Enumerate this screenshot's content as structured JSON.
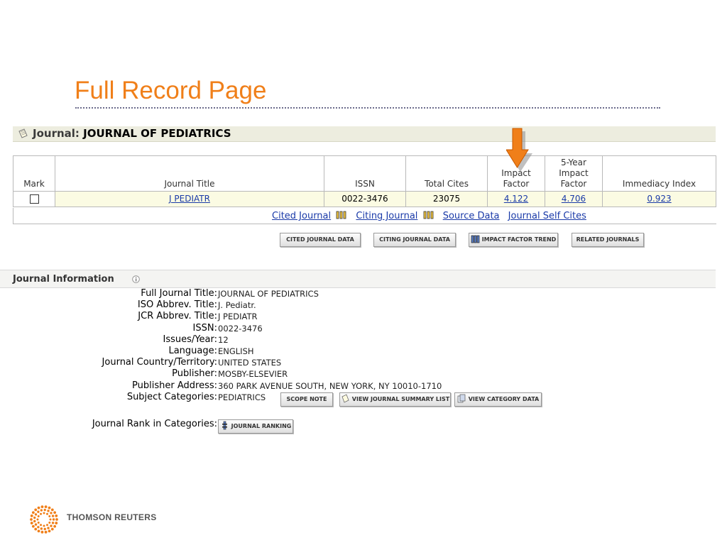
{
  "slide": {
    "title": "Full Record Page"
  },
  "journal": {
    "label": "Journal:",
    "name": "JOURNAL OF PEDIATRICS"
  },
  "table": {
    "headers": {
      "mark": "Mark",
      "title": "Journal Title",
      "issn": "ISSN",
      "total_cites": "Total Cites",
      "impact_factor_l1": "Impact",
      "impact_factor_l2": "Factor",
      "five_year_l1": "5-Year",
      "five_year_l2": "Impact",
      "five_year_l3": "Factor",
      "immediacy": "Immediacy Index"
    },
    "row": {
      "title": "J PEDIATR",
      "issn": "0022-3476",
      "total_cites": "23075",
      "impact_factor": "4.122",
      "five_year": "4.706",
      "immediacy": "0.923"
    }
  },
  "links": {
    "cited_journal": "Cited Journal",
    "citing_journal": "Citing Journal",
    "source_data": "Source Data",
    "self_cites": "Journal Self Cites"
  },
  "buttons": {
    "cited_data": "CITED JOURNAL DATA",
    "citing_data": "CITING JOURNAL DATA",
    "if_trend": "IMPACT FACTOR TREND",
    "related": "RELATED JOURNALS",
    "scope_note": "SCOPE NOTE",
    "summary_list": "VIEW JOURNAL SUMMARY LIST",
    "category_data": "VIEW CATEGORY DATA",
    "ranking": "JOURNAL RANKING"
  },
  "info": {
    "heading": "Journal Information",
    "fields": [
      {
        "key": "Full Journal Title:",
        "value": "JOURNAL OF PEDIATRICS"
      },
      {
        "key": "ISO Abbrev. Title:",
        "value": "J. Pediatr."
      },
      {
        "key": "JCR Abbrev. Title:",
        "value": "J PEDIATR"
      },
      {
        "key": "ISSN:",
        "value": "0022-3476"
      },
      {
        "key": "Issues/Year:",
        "value": "12"
      },
      {
        "key": "Language:",
        "value": "ENGLISH"
      },
      {
        "key": "Journal Country/Territory:",
        "value": "UNITED STATES"
      },
      {
        "key": "Publisher:",
        "value": "MOSBY-ELSEVIER"
      },
      {
        "key": "Publisher Address:",
        "value": "360 PARK AVENUE SOUTH, NEW YORK, NY 10010-1710"
      },
      {
        "key": "Subject Categories:",
        "value": "PEDIATRICS"
      }
    ],
    "rank_label": "Journal Rank in Categories:"
  },
  "footer": {
    "brand": "THOMSON REUTERS"
  },
  "colors": {
    "title": "#f07f19",
    "link": "#1a3aa8",
    "row_bg": "#fbfbe3",
    "arrow": "#f07f19"
  }
}
